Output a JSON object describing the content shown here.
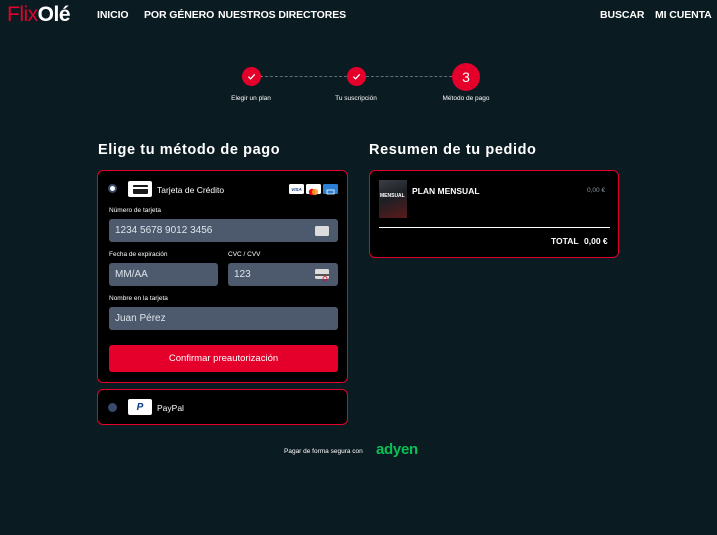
{
  "header": {
    "logo_part1": "Flix",
    "logo_part2": "Olé",
    "nav": {
      "inicio": "INICIO",
      "por_genero": "POR GÉNERO",
      "directores": "NUESTROS DIRECTORES",
      "buscar": "BUSCAR",
      "mi_cuenta": "MI CUENTA"
    }
  },
  "stepper": {
    "steps": [
      {
        "label": "Elegir un plan",
        "state": "done",
        "icon": "check-icon"
      },
      {
        "label": "Tu suscripción",
        "state": "done",
        "icon": "check-icon"
      },
      {
        "label": "Método de pago",
        "state": "current",
        "number": "3"
      }
    ],
    "accent_color": "#e4002b"
  },
  "payment": {
    "title": "Elige tu método de pago",
    "card_option": {
      "label": "Tarjeta de Crédito",
      "selected": true,
      "brands": [
        "visa-icon",
        "mastercard-icon",
        "amex-icon"
      ],
      "card_number": {
        "label": "Número de tarjeta",
        "placeholder": "1234 5678 9012 3456"
      },
      "expiry": {
        "label": "Fecha de expiración",
        "placeholder": "MM/AA"
      },
      "cvc": {
        "label": "CVC / CVV",
        "placeholder": "123"
      },
      "holder": {
        "label": "Nombre en la tarjeta",
        "placeholder": "Juan Pérez"
      },
      "confirm_label": "Confirmar preautorización"
    },
    "paypal_option": {
      "label": "PayPal",
      "selected": false
    }
  },
  "summary": {
    "title": "Resumen de tu pedido",
    "item_name": "PLAN MENSUAL",
    "item_price": "0,00 €",
    "poster_text": "MENSUAL",
    "total_label": "TOTAL",
    "total_value": "0,00 €"
  },
  "footer": {
    "secure_text": "Pagar de forma segura con",
    "brand": "adyen"
  }
}
